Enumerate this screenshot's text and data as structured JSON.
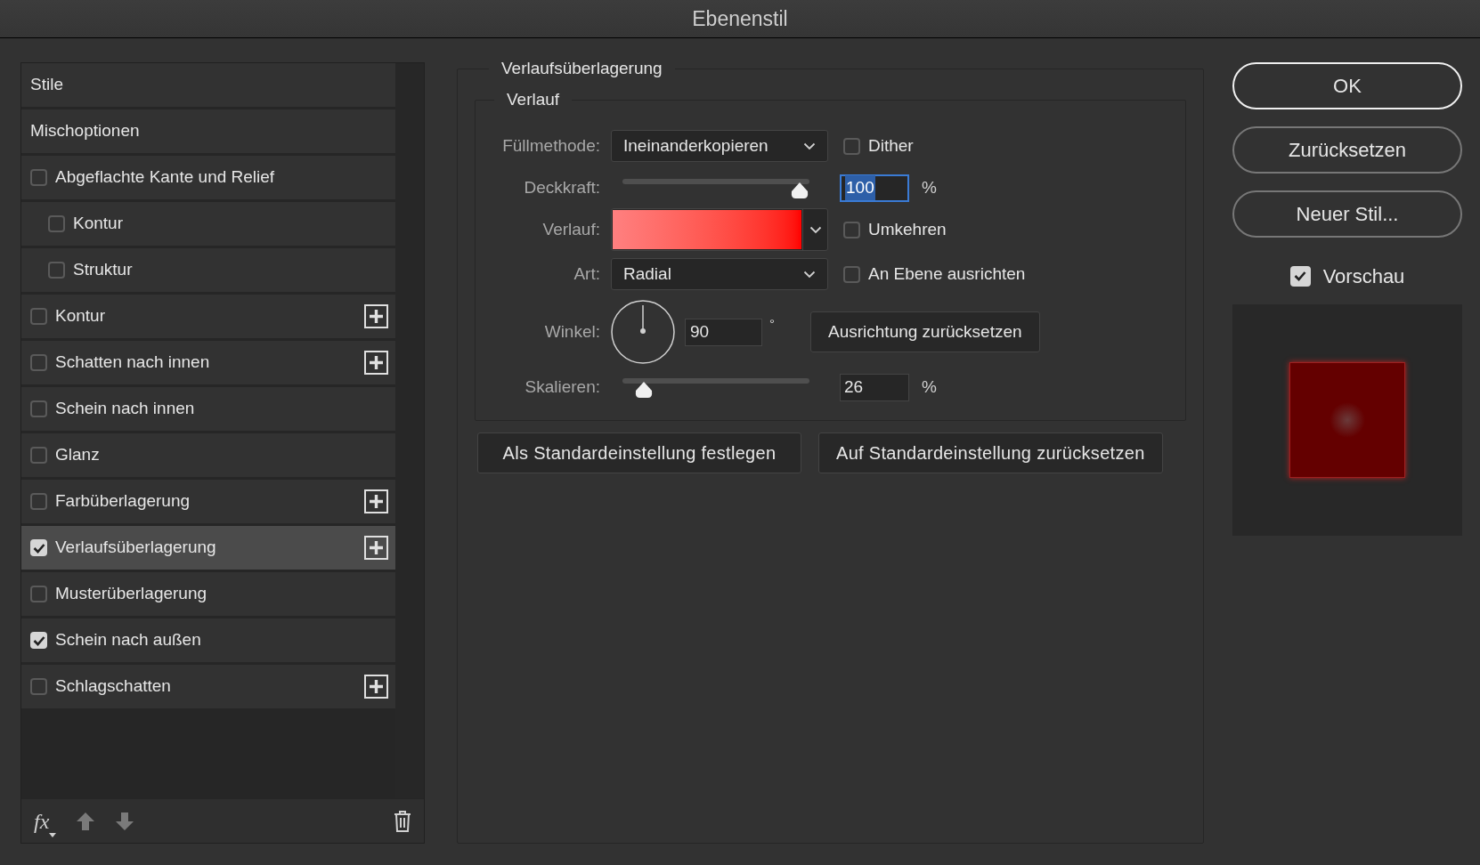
{
  "window": {
    "title": "Ebenenstil"
  },
  "styles_list": [
    {
      "kind": "header",
      "label": "Stile",
      "selected": false
    },
    {
      "kind": "header",
      "label": "Mischoptionen",
      "selected": false
    },
    {
      "kind": "checkbox",
      "label": "Abgeflachte Kante und Relief",
      "checked": false,
      "selected": false,
      "children": [
        {
          "kind": "checkbox",
          "label": "Kontur",
          "checked": false,
          "selected": false
        },
        {
          "kind": "checkbox",
          "label": "Struktur",
          "checked": false,
          "selected": false
        }
      ]
    },
    {
      "kind": "checkbox",
      "label": "Kontur",
      "checked": false,
      "selected": false,
      "add_button": true
    },
    {
      "kind": "checkbox",
      "label": "Schatten nach innen",
      "checked": false,
      "selected": false,
      "add_button": true
    },
    {
      "kind": "checkbox",
      "label": "Schein nach innen",
      "checked": false,
      "selected": false
    },
    {
      "kind": "checkbox",
      "label": "Glanz",
      "checked": false,
      "selected": false
    },
    {
      "kind": "checkbox",
      "label": "Farbüberlagerung",
      "checked": false,
      "selected": false,
      "add_button": true
    },
    {
      "kind": "checkbox",
      "label": "Verlaufsüberlagerung",
      "checked": true,
      "selected": true,
      "add_button": true
    },
    {
      "kind": "checkbox",
      "label": "Musterüberlagerung",
      "checked": false,
      "selected": false
    },
    {
      "kind": "checkbox",
      "label": "Schein nach außen",
      "checked": true,
      "selected": false
    },
    {
      "kind": "checkbox",
      "label": "Schlagschatten",
      "checked": false,
      "selected": false,
      "add_button": true
    }
  ],
  "list_footer": {
    "fx_label": "fx"
  },
  "panel": {
    "title": "Verlaufsüberlagerung",
    "group_title": "Verlauf",
    "rows": [
      {
        "kind": "dropdown",
        "label": "Füllmethode:",
        "value": "Ineinanderkopieren",
        "option": {
          "label": "Dither",
          "checked": false
        }
      },
      {
        "kind": "slider",
        "label": "Deckkraft:",
        "level": 1,
        "value": "100",
        "unit": "%",
        "focused": true
      },
      {
        "kind": "gradient",
        "label": "Verlauf:",
        "option": {
          "label": "Umkehren",
          "checked": false
        }
      },
      {
        "kind": "dropdown",
        "label": "Art:",
        "value": "Radial",
        "option": {
          "label": "An Ebene ausrichten",
          "checked": false
        }
      },
      {
        "kind": "angle",
        "label": "Winkel:",
        "value": "90",
        "unit": "°",
        "button": "Ausrichtung zurücksetzen"
      },
      {
        "kind": "slider",
        "label": "Skalieren:",
        "level": 0.07,
        "value": "26",
        "unit": "%",
        "focused": false
      }
    ],
    "buttons": [
      "Als Standardeinstellung festlegen",
      "Auf Standardeinstellung zurücksetzen"
    ]
  },
  "dialog_buttons": [
    {
      "label": "OK",
      "default": true
    },
    {
      "label": "Zurücksetzen",
      "default": false
    },
    {
      "label": "Neuer Stil...",
      "default": false
    }
  ],
  "preview": {
    "label": "Vorschau",
    "checked": true
  }
}
